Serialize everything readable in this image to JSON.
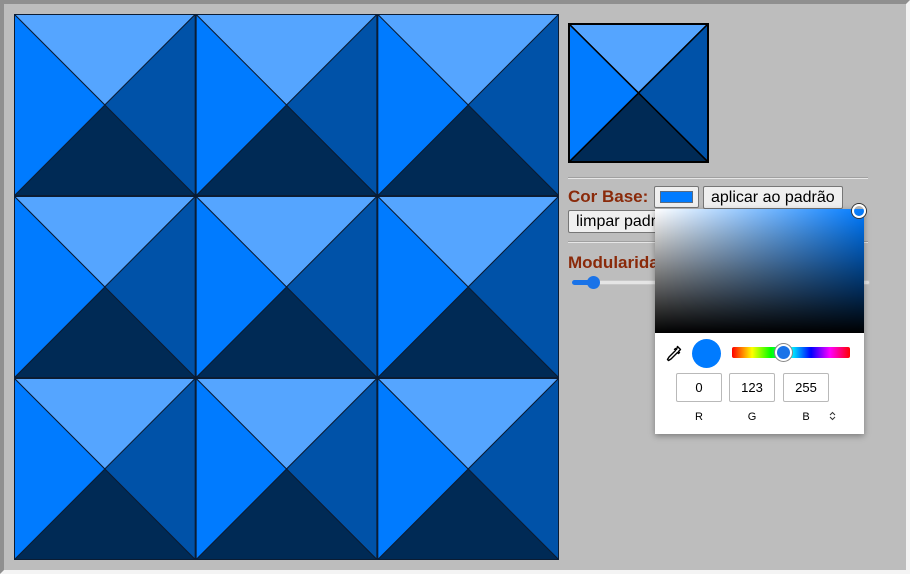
{
  "colors": {
    "base": "#007bff",
    "light": "#55a5ff",
    "medium": "#0052a8",
    "dark": "#002a55",
    "stroke": "#0b1c33"
  },
  "pattern": {
    "rows": 3,
    "cols": 3
  },
  "controls": {
    "base_label": "Cor Base:",
    "apply_label": "aplicar ao padrão",
    "clear_label": "limpar padrão",
    "modularity_label": "Modularidade",
    "slider_fraction": 0.05
  },
  "picker": {
    "r": "0",
    "g": "123",
    "b": "255",
    "r_label": "R",
    "g_label": "G",
    "b_label": "B",
    "mode_icon": "up-down-chevron-icon",
    "eyedropper_icon": "eyedropper-icon"
  }
}
